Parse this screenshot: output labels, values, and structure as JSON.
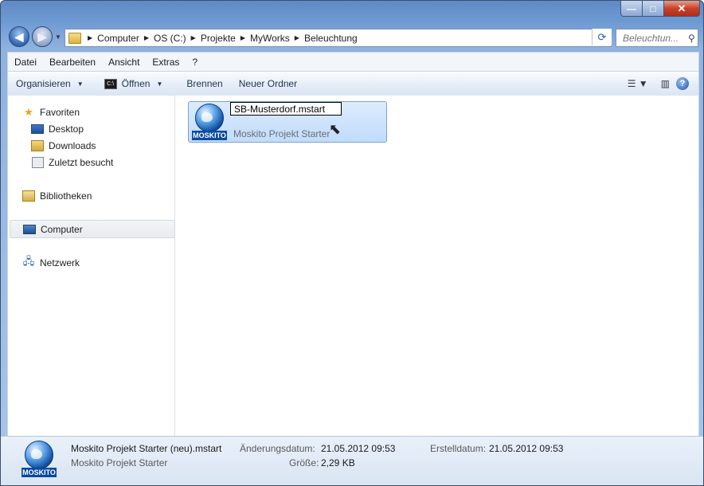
{
  "window": {
    "controls": {
      "minimize": "—",
      "maximize": "□",
      "close": "✕"
    }
  },
  "address": {
    "crumbs": [
      "Computer",
      "OS (C:)",
      "Projekte",
      "MyWorks",
      "Beleuchtung"
    ],
    "search_placeholder": "Beleuchtun..."
  },
  "menu": [
    "Datei",
    "Bearbeiten",
    "Ansicht",
    "Extras",
    "?"
  ],
  "toolbar": {
    "organize": "Organisieren",
    "open": "Öffnen",
    "burn": "Brennen",
    "new_folder": "Neuer Ordner",
    "open_icon_text": "C:\\"
  },
  "sidebar": {
    "items": [
      {
        "label": "Favoriten",
        "icon": "star-icon"
      },
      {
        "label": "Desktop",
        "icon": "desktop-icon"
      },
      {
        "label": "Downloads",
        "icon": "downloads-folder-icon"
      },
      {
        "label": "Zuletzt besucht",
        "icon": "recent-places-icon"
      },
      {
        "label": "Bibliotheken",
        "icon": "libraries-icon"
      },
      {
        "label": "Computer",
        "icon": "computer-icon"
      },
      {
        "label": "Netzwerk",
        "icon": "network-icon"
      }
    ]
  },
  "file": {
    "rename_value": "SB-Musterdorf.mstart",
    "type": "Moskito Projekt Starter",
    "logo_text": "MOSKITO"
  },
  "details": {
    "name": "Moskito Projekt Starter (neu).mstart",
    "type": "Moskito Projekt Starter",
    "modified_label": "Änderungsdatum:",
    "modified_value": "21.05.2012 09:53",
    "size_label": "Größe:",
    "size_value": "2,29 KB",
    "created_label": "Erstelldatum:",
    "created_value": "21.05.2012 09:53"
  }
}
